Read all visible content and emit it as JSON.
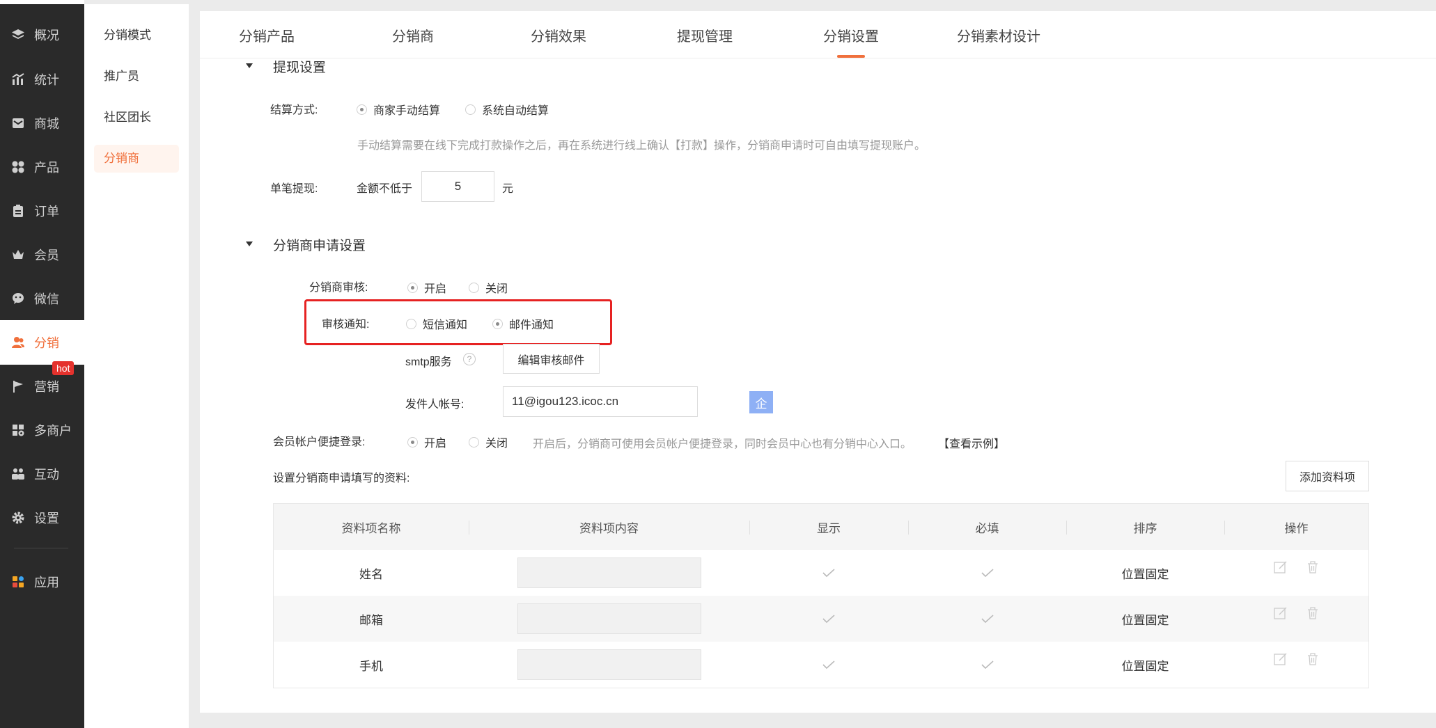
{
  "nav": {
    "items": [
      {
        "label": "概况",
        "icon": "layers-icon"
      },
      {
        "label": "统计",
        "icon": "chart-icon"
      },
      {
        "label": "商城",
        "icon": "mail-store-icon"
      },
      {
        "label": "产品",
        "icon": "grid-icon"
      },
      {
        "label": "订单",
        "icon": "clipboard-icon"
      },
      {
        "label": "会员",
        "icon": "crown-icon"
      },
      {
        "label": "微信",
        "icon": "wechat-icon"
      },
      {
        "label": "分销",
        "icon": "users-icon"
      },
      {
        "label": "营销",
        "icon": "flag-icon"
      },
      {
        "label": "多商户",
        "icon": "merchant-icon"
      },
      {
        "label": "互动",
        "icon": "interact-icon"
      },
      {
        "label": "设置",
        "icon": "gear-icon"
      },
      {
        "label": "应用",
        "icon": "apps-icon"
      }
    ],
    "active_index": 7,
    "hot_badge": "hot",
    "colors": {
      "accent": "#f0703c",
      "nav_bg": "#2a2a2a"
    }
  },
  "subnav": {
    "items": [
      "分销模式",
      "推广员",
      "社区团长",
      "分销商"
    ],
    "active_index": 3
  },
  "tabs": {
    "items": [
      "分销产品",
      "分销商",
      "分销效果",
      "提现管理",
      "分销设置",
      "分销素材设计"
    ],
    "active_index": 4
  },
  "withdraw": {
    "title": "提现设置",
    "settle_label": "结算方式:",
    "settle_options": [
      "商家手动结算",
      "系统自动结算"
    ],
    "settle_selected": 0,
    "settle_hint": "手动结算需要在线下完成打款操作之后，再在系统进行线上确认【打款】操作，分销商申请时可自由填写提现账户。",
    "single_label": "单笔提现:",
    "min_prefix": "金额不低于",
    "min_value": "5",
    "min_unit": "元"
  },
  "apply": {
    "title": "分销商申请设置",
    "audit_label": "分销商审核:",
    "audit_options": [
      "开启",
      "关闭"
    ],
    "audit_selected": 0,
    "notify_label": "审核通知:",
    "notify_options": [
      "短信通知",
      "邮件通知"
    ],
    "notify_selected": 1,
    "smtp_label": "smtp服务",
    "smtp_help": "?",
    "edit_mail_button": "编辑审核邮件",
    "sender_label": "发件人帐号:",
    "sender_value": "11@igou123.icoc.cn",
    "sender_btn": "企",
    "quick_login_label": "会员帐户便捷登录:",
    "quick_login_options": [
      "开启",
      "关闭"
    ],
    "quick_login_selected": 0,
    "quick_login_hint": "开启后，分销商可使用会员帐户便捷登录，同时会员中心也有分销中心入口。",
    "quick_login_link": "【查看示例】",
    "fields_label": "设置分销商申请填写的资料:",
    "add_field_button": "添加资料项"
  },
  "table": {
    "headers": [
      "资料项名称",
      "资料项内容",
      "显示",
      "必填",
      "排序",
      "操作"
    ],
    "rows": [
      {
        "name": "姓名",
        "sort": "位置固定"
      },
      {
        "name": "邮箱",
        "sort": "位置固定"
      },
      {
        "name": "手机",
        "sort": "位置固定"
      }
    ]
  }
}
